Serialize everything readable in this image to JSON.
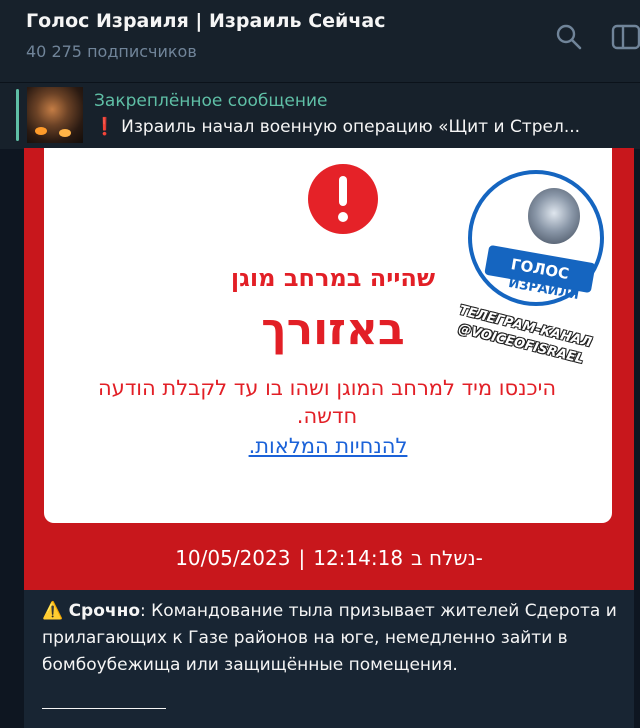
{
  "header": {
    "title": "Голос Израиля | Израиль Сейчас",
    "subscribers": "40 275 подписчиков",
    "search_icon": "search-icon",
    "sidebar_icon": "sidebar-toggle-icon"
  },
  "pinned": {
    "label": "Закреплённое сообщение",
    "excl": "❗",
    "text": "Израиль начал военную операцию «Щит и Стрел..."
  },
  "alert": {
    "subtitle": "שהייה במרחב מוגן",
    "main": "באזורך",
    "instruction": "היכנסו מיד למרחב המוגן ושהו בו עד לקבלת הודעה חדשה.",
    "link": "להנחיות המלאות.",
    "sent_label": "נשלח ב-",
    "time": "12:14:18",
    "sep": "|",
    "date": "10/05/2023",
    "colors": {
      "red": "#e21f26",
      "frame": "#c8171c",
      "link": "#1b62d8"
    }
  },
  "logo": {
    "banner": "ГОЛОС",
    "word": "ИЗРАИЛЯ",
    "watermark_line1": "ТЕЛЕГРАМ-КАНАЛ",
    "watermark_line2": "@VOICEOFISRAEL"
  },
  "message": {
    "warn_icon": "⚠️",
    "bold": "Срочно",
    "colon": ":",
    "text": " Командование тыла призывает жителей Сдерота и прилагающих к Газе районов на юге, немедленно зайти в бомбоубежища или защищённые помещения."
  }
}
